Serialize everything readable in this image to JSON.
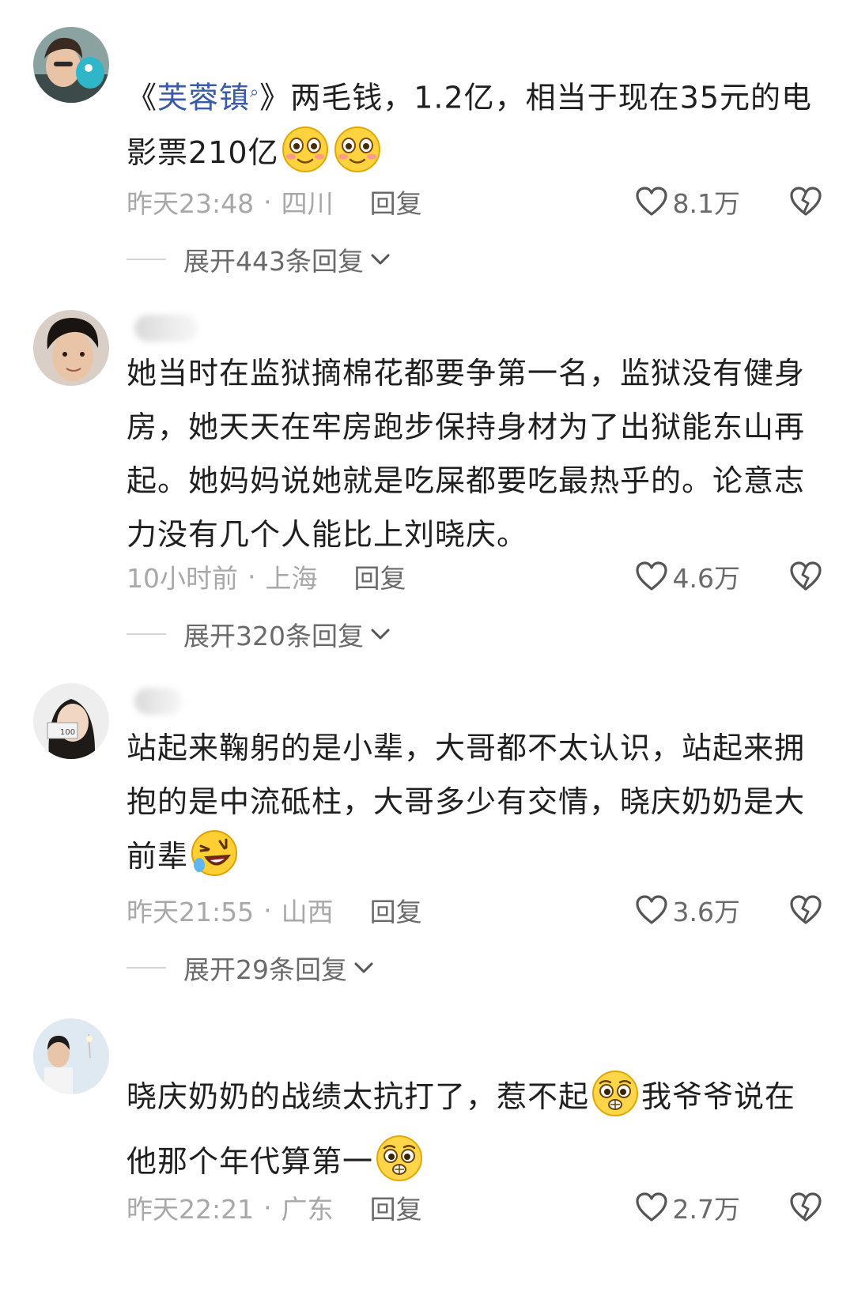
{
  "comments": [
    {
      "text_before_link": "《",
      "link": "芙蓉镇",
      "text_after_link": "》两毛钱，1.2亿，相当于现在35元的电影票210亿",
      "time": "昨天23:48",
      "location": "四川",
      "reply_label": "回复",
      "likes": "8.1万",
      "expand_label": "展开443条回复"
    },
    {
      "text": "她当时在监狱摘棉花都要争第一名，监狱没有健身房，她天天在牢房跑步保持身材为了出狱能东山再起。她妈妈说她就是吃屎都要吃最热乎的。论意志力没有几个人能比上刘晓庆。",
      "time": "10小时前",
      "location": "上海",
      "reply_label": "回复",
      "likes": "4.6万",
      "expand_label": "展开320条回复"
    },
    {
      "text": "站起来鞠躬的是小辈，大哥都不太认识，站起来拥抱的是中流砥柱，大哥多少有交情，晓庆奶奶是大前辈",
      "time": "昨天21:55",
      "location": "山西",
      "reply_label": "回复",
      "likes": "3.6万",
      "expand_label": "展开29条回复"
    },
    {
      "text_part1": "晓庆奶奶的战绩太抗打了，惹不起",
      "text_part2": "我爷爷说在他那个年代算第一",
      "time": "昨天22:21",
      "location": "广东",
      "reply_label": "回复",
      "likes": "2.7万"
    }
  ],
  "meta_separator": "·",
  "icons": {
    "like": "heart-outline-icon",
    "dislike": "broken-heart-icon",
    "expand": "chevron-down-icon",
    "search_mark": "search-icon",
    "emoji_1": "blushing-smile-emoji",
    "emoji_3": "rolling-laugh-emoji",
    "emoji_4": "pleading-face-emoji"
  },
  "colors": {
    "link": "#3a5ba8",
    "meta_text": "#a8a8a8",
    "action_text": "#6a6a6a"
  }
}
